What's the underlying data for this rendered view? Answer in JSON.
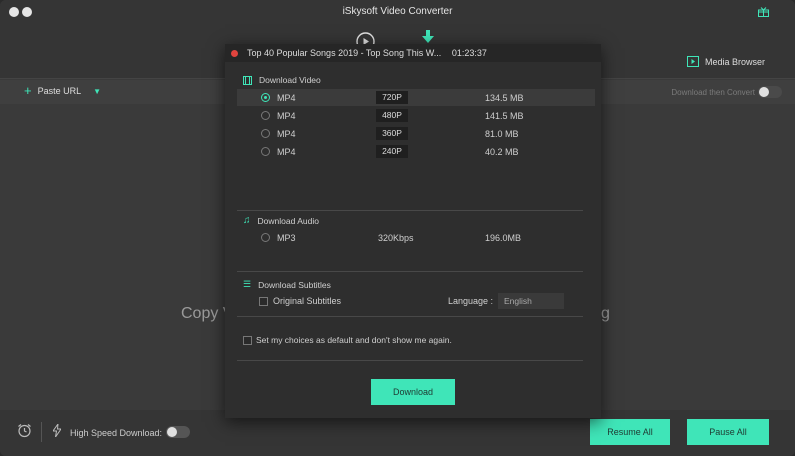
{
  "window": {
    "title": "iSkysoft Video Converter"
  },
  "toolbar": {
    "media_browser_label": "Media Browser"
  },
  "subbar": {
    "paste_url_label": "Paste URL",
    "download_then_convert_label": "Download then Convert"
  },
  "background": {
    "hint_left": "Copy V",
    "hint_right": "g"
  },
  "bottombar": {
    "high_speed_label": "High Speed Download:",
    "resume_all_label": "Resume All",
    "pause_all_label": "Pause All"
  },
  "dialog": {
    "title": "Top 40 Popular Songs 2019 - Top Song This W...",
    "duration": "01:23:37",
    "video_section_label": "Download Video",
    "video_options": [
      {
        "format": "MP4",
        "resolution": "720P",
        "size": "134.5 MB",
        "selected": true
      },
      {
        "format": "MP4",
        "resolution": "480P",
        "size": "141.5 MB",
        "selected": false
      },
      {
        "format": "MP4",
        "resolution": "360P",
        "size": "81.0 MB",
        "selected": false
      },
      {
        "format": "MP4",
        "resolution": "240P",
        "size": "40.2 MB",
        "selected": false
      }
    ],
    "audio_section_label": "Download Audio",
    "audio_option": {
      "format": "MP3",
      "bitrate": "320Kbps",
      "size": "196.0MB"
    },
    "subtitles_section_label": "Download Subtitles",
    "original_subtitles_label": "Original Subtitles",
    "language_label": "Language :",
    "language_value": "English",
    "default_choice_label": "Set my choices as default and don't show me again.",
    "download_label": "Download"
  },
  "colors": {
    "accent": "#3fe5b8",
    "close": "#e0443e"
  }
}
